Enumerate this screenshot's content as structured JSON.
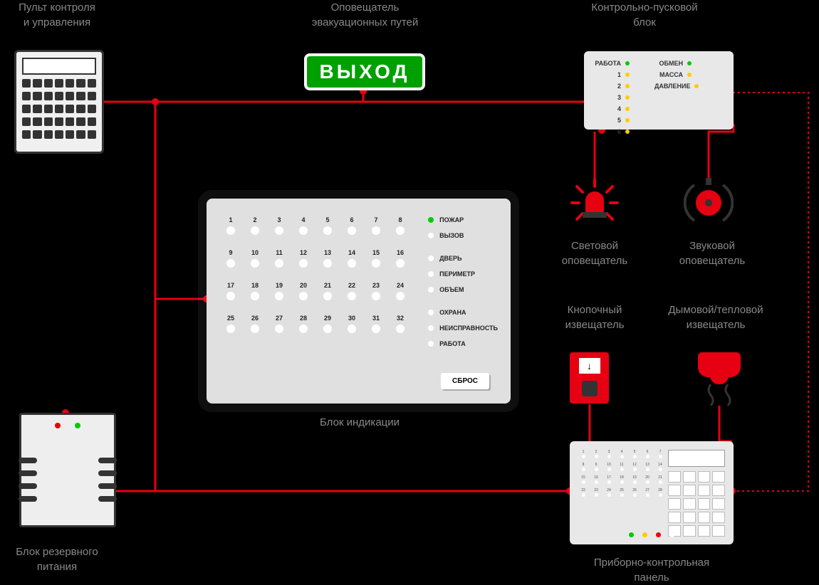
{
  "labels": {
    "control_panel": "Пульт контроля\nи управления",
    "exit_annunciator": "Оповещатель\nэвакуационных путей",
    "control_start_block": "Контрольно-пусковой\nблок",
    "indication_block": "Блок индикации",
    "backup_power": "Блок резервного\nпитания",
    "light_alarm": "Световой\nоповещатель",
    "sound_alarm": "Звуковой\nоповещатель",
    "call_point": "Кнопочный\nизвещатель",
    "smoke_heat": "Дымовой/тепловой\nизвещатель",
    "instrument_panel": "Приборно-контрольная\nпанель"
  },
  "exit_sign_text": "ВЫХОД",
  "csb": {
    "left": [
      {
        "label": "РАБОТА",
        "color": "green"
      },
      {
        "label": "1",
        "color": "yellow"
      },
      {
        "label": "2",
        "color": "yellow"
      },
      {
        "label": "3",
        "color": "yellow"
      },
      {
        "label": "4",
        "color": "yellow"
      },
      {
        "label": "5",
        "color": "yellow"
      },
      {
        "label": "6",
        "color": "yellow"
      }
    ],
    "right": [
      {
        "label": "ОБМЕН",
        "color": "green"
      },
      {
        "label": "МАССА",
        "color": "yellow"
      },
      {
        "label": "ДАВЛЕНИЕ",
        "color": "yellow"
      }
    ]
  },
  "indication": {
    "zone_count": 32,
    "statuses": [
      {
        "label": "ПОЖАР",
        "color": "green"
      },
      {
        "label": "ВЫЗОВ",
        "color": "off"
      },
      {
        "label": "ДВЕРЬ",
        "color": "off"
      },
      {
        "label": "ПЕРИМЕТР",
        "color": "off"
      },
      {
        "label": "ОБЪЕМ",
        "color": "off"
      },
      {
        "label": "ОХРАНА",
        "color": "off"
      },
      {
        "label": "НЕИСПРАВНОСТЬ",
        "color": "off"
      },
      {
        "label": "РАБОТА",
        "color": "off"
      }
    ],
    "reset": "СБРОС"
  },
  "ipanel": {
    "zone_count": 28,
    "leds": [
      "green",
      "yellow",
      "red",
      "white"
    ]
  }
}
